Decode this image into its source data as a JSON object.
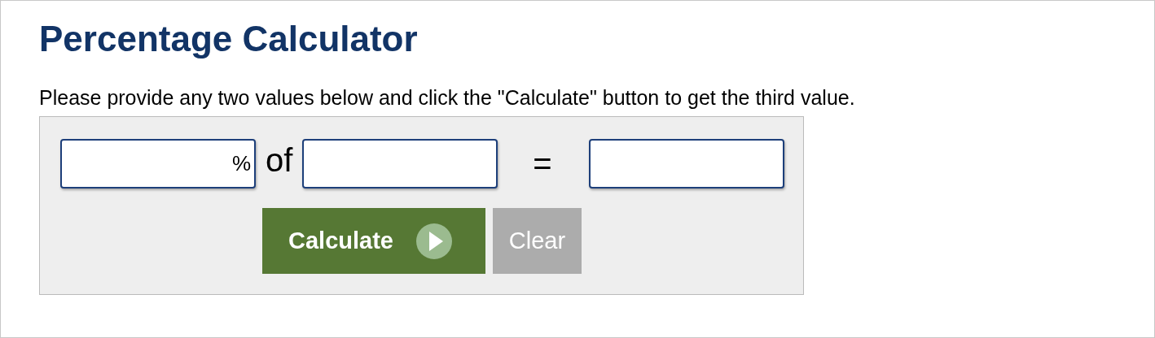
{
  "title": "Percentage Calculator",
  "intro": "Please provide any two values below and click the \"Calculate\" button to get the third value.",
  "equation": [
    {
      "kind": "field",
      "suffix": "%"
    },
    {
      "kind": "word",
      "text": "of"
    },
    {
      "kind": "field"
    },
    {
      "kind": "word",
      "text": "="
    },
    {
      "kind": "field"
    }
  ],
  "buttons": [
    {
      "label": "Calculate",
      "kind": "primary"
    },
    {
      "label": "Clear",
      "kind": "secondary"
    }
  ]
}
